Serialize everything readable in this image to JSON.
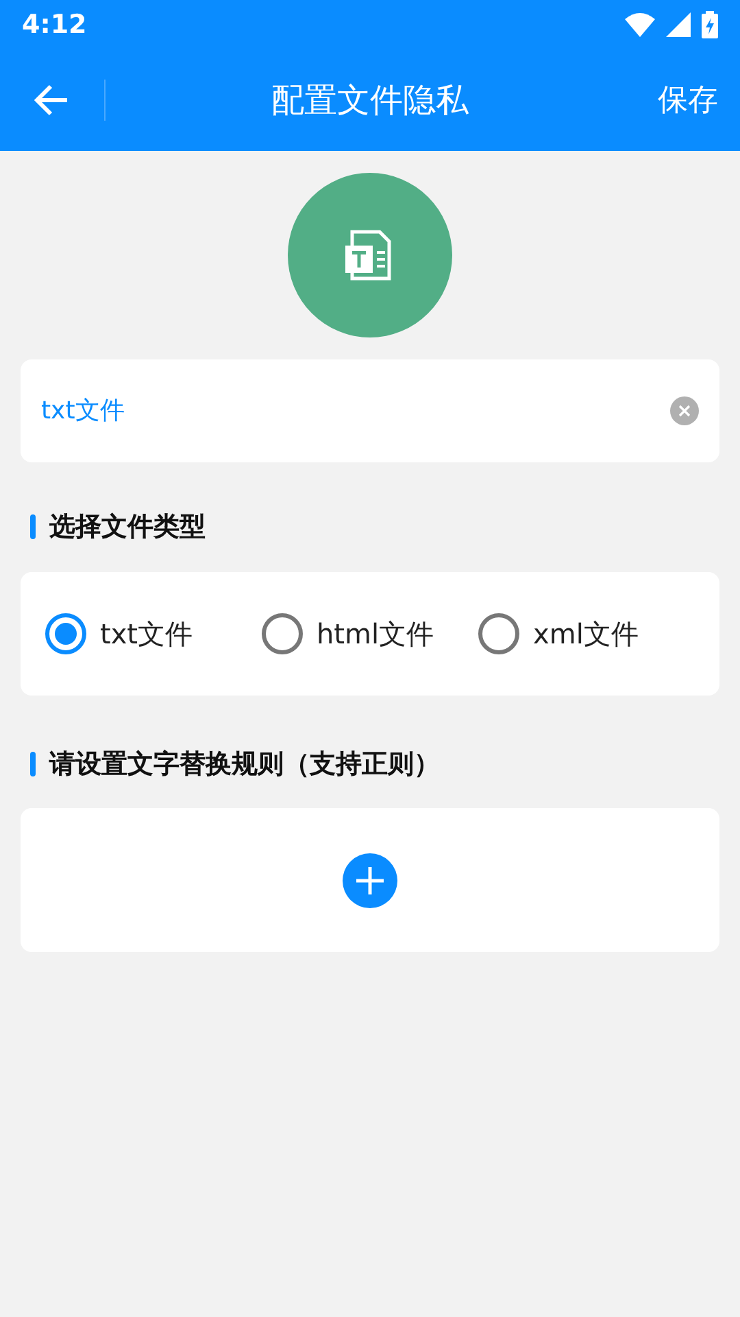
{
  "status_bar": {
    "time": "4:12"
  },
  "app_bar": {
    "title": "配置文件隐私",
    "action": "保存"
  },
  "name_field": {
    "value": "txt文件"
  },
  "file_type_section": {
    "heading": "选择文件类型",
    "options": [
      {
        "label": "txt文件",
        "selected": true
      },
      {
        "label": "html文件",
        "selected": false
      },
      {
        "label": "xml文件",
        "selected": false
      }
    ]
  },
  "rules_section": {
    "heading": "请设置文字替换规则（支持正则）"
  }
}
